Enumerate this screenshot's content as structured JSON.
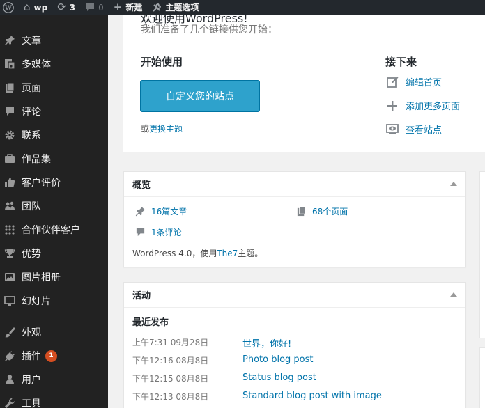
{
  "admin_bar": {
    "site_name": "wp",
    "updates_count": "3",
    "comments_count": "0",
    "new_label": "新建",
    "theme_options_label": "主题选项"
  },
  "sidebar": {
    "items": [
      {
        "label": "文章",
        "icon": "pin-icon"
      },
      {
        "label": "多媒体",
        "icon": "media-icon"
      },
      {
        "label": "页面",
        "icon": "page-icon"
      },
      {
        "label": "评论",
        "icon": "comment-icon"
      },
      {
        "label": "联系",
        "icon": "gear-icon"
      },
      {
        "label": "作品集",
        "icon": "portfolio-icon"
      },
      {
        "label": "客户评价",
        "icon": "thumbs-up-icon"
      },
      {
        "label": "团队",
        "icon": "team-icon"
      },
      {
        "label": "合作伙伴客户",
        "icon": "grid-icon"
      },
      {
        "label": "优势",
        "icon": "trophy-icon"
      },
      {
        "label": "图片相册",
        "icon": "gallery-icon"
      },
      {
        "label": "幻灯片",
        "icon": "slides-icon"
      },
      {
        "label": "外观",
        "icon": "brush-icon"
      },
      {
        "label": "插件",
        "icon": "plugin-icon",
        "badge": "1"
      },
      {
        "label": "用户",
        "icon": "user-icon"
      },
      {
        "label": "工具",
        "icon": "wrench-icon"
      }
    ]
  },
  "welcome": {
    "title_cutoff": "欢迎使用WordPress!",
    "subtitle": "我们准备了几个链接供您开始：",
    "get_started_heading": "开始使用",
    "customize_button": "自定义您的站点",
    "or_text": "或",
    "change_theme_link": "更换主题",
    "next_steps_heading": "接下来",
    "next_steps": [
      {
        "label": "编辑首页",
        "icon": "edit-icon"
      },
      {
        "label": "添加更多页面",
        "icon": "plus-icon"
      },
      {
        "label": "查看站点",
        "icon": "view-icon"
      }
    ]
  },
  "at_a_glance": {
    "title": "概览",
    "posts": "16篇文章",
    "pages": "68个页面",
    "comments": "1条评论",
    "wp_version_prefix": "WordPress 4.0，使用",
    "theme_name": "The7",
    "wp_version_suffix": "主题。"
  },
  "activity": {
    "title": "活动",
    "recent_heading": "最近发布",
    "posts": [
      {
        "date": "上午7:31 09月28日",
        "title": "世界，你好!"
      },
      {
        "date": "下午12:16 08月8日",
        "title": "Photo blog post"
      },
      {
        "date": "下午12:15 08月8日",
        "title": "Status blog post"
      },
      {
        "date": "下午12:13 08月8日",
        "title": "Standard blog post with image"
      }
    ]
  },
  "colors": {
    "admin_bar_bg": "#23282d",
    "sidebar_bg": "#222222",
    "primary_button": "#2ea2cc",
    "link": "#0073aa",
    "badge": "#d54e21"
  }
}
